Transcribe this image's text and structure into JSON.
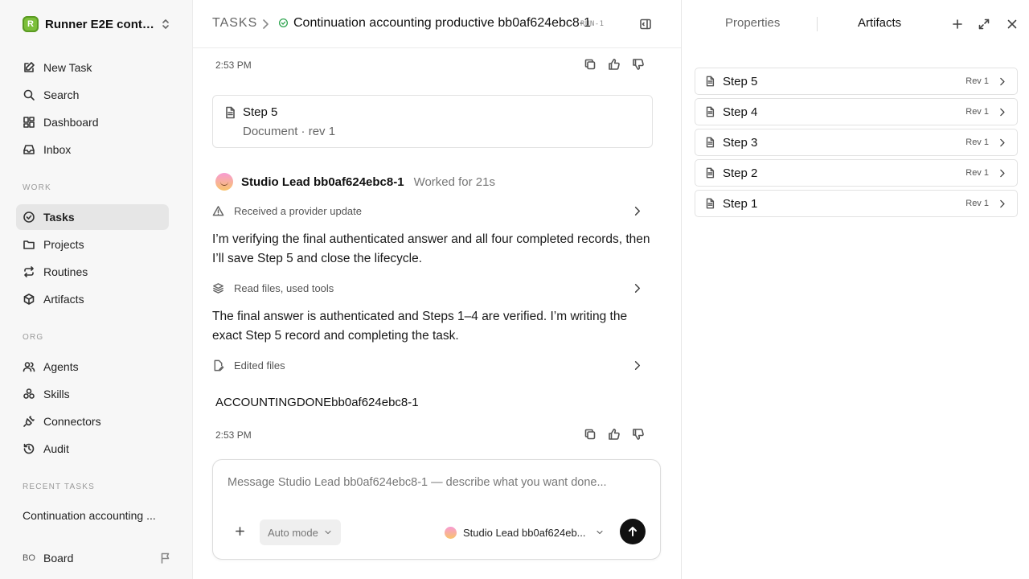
{
  "workspace": {
    "logo_letter": "R",
    "name": "Runner E2E conti..."
  },
  "nav_main": [
    {
      "label": "New Task",
      "icon": "edit-icon"
    },
    {
      "label": "Search",
      "icon": "search-icon"
    },
    {
      "label": "Dashboard",
      "icon": "dashboard-icon"
    },
    {
      "label": "Inbox",
      "icon": "inbox-icon"
    }
  ],
  "sections": {
    "work": "WORK",
    "org": "ORG",
    "recent": "RECENT TASKS"
  },
  "nav_work": [
    {
      "label": "Tasks",
      "active": true
    },
    {
      "label": "Projects"
    },
    {
      "label": "Routines"
    },
    {
      "label": "Artifacts"
    }
  ],
  "nav_org": [
    {
      "label": "Agents"
    },
    {
      "label": "Skills"
    },
    {
      "label": "Connectors"
    },
    {
      "label": "Audit"
    }
  ],
  "recent_task": "Continuation accounting ...",
  "user": {
    "initials": "BO",
    "name": "Board"
  },
  "header": {
    "root": "TASKS",
    "title": "Continuation accounting productive bb0af624ebc8-1",
    "run": "RUN-1"
  },
  "thread": {
    "time1": "2:53 PM",
    "doc_card": {
      "title": "Step 5",
      "subtitle": "Document · rev 1"
    },
    "agent": {
      "name": "Studio Lead bb0af624ebc8-1",
      "worked": "Worked for 21s"
    },
    "step1": "Received a provider update",
    "para1": "I’m verifying the final authenticated answer and all four completed records, then I’ll save Step 5 and close the lifecycle.",
    "step2": "Read files, used tools",
    "para2": "The final answer is authenticated and Steps 1–4 are verified. I’m writing the exact Step 5 record and completing the task.",
    "step3": "Edited files",
    "final": "ACCOUNTINGDONEbb0af624ebc8-1",
    "time2": "2:53 PM"
  },
  "composer": {
    "placeholder": "Message Studio Lead bb0af624ebc8-1 — describe what you want done...",
    "mode": "Auto mode",
    "agent": "Studio Lead bb0af624eb..."
  },
  "right_panel": {
    "tab_properties": "Properties",
    "tab_artifacts": "Artifacts",
    "active_tab": "Artifacts",
    "artifacts": [
      {
        "name": "Step 5",
        "rev": "Rev 1"
      },
      {
        "name": "Step 4",
        "rev": "Rev 1"
      },
      {
        "name": "Step 3",
        "rev": "Rev 1"
      },
      {
        "name": "Step 2",
        "rev": "Rev 1"
      },
      {
        "name": "Step 1",
        "rev": "Rev 1"
      }
    ]
  },
  "colors": {
    "accent_status": "#2ea44f",
    "send_button": "#111111",
    "active_nav_bg": "#e6e6e6"
  }
}
